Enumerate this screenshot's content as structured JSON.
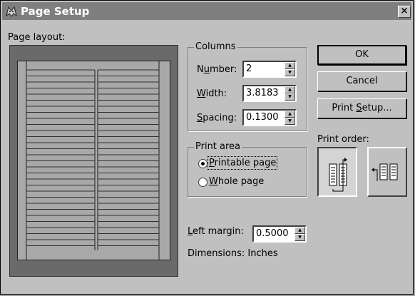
{
  "window": {
    "title": "Page Setup",
    "close_glyph": "×",
    "icon": "app-icon"
  },
  "page_layout": {
    "label": "Page layout:",
    "columns_shown": 2
  },
  "columns": {
    "group_label": "Columns",
    "number": {
      "label_pre": "N",
      "label_key": "u",
      "label_post": "mber:",
      "value": "2"
    },
    "width": {
      "label_pre": "",
      "label_key": "W",
      "label_post": "idth:",
      "value": "3.8183"
    },
    "spacing": {
      "label_pre": "",
      "label_key": "S",
      "label_post": "pacing:",
      "value": "0.1300"
    }
  },
  "print_area": {
    "group_label": "Print area",
    "options": [
      {
        "label_pre": "",
        "label_key": "P",
        "label_post": "rintable page",
        "selected": true
      },
      {
        "label_pre": "",
        "label_key": "W",
        "label_post": "hole page",
        "selected": false
      }
    ]
  },
  "left_margin": {
    "label_pre": "",
    "label_key": "L",
    "label_post": "eft margin:",
    "value": "0.5000"
  },
  "dimensions_text": "Dimensions: Inches",
  "buttons": {
    "ok": "OK",
    "cancel": "Cancel",
    "print_setup_pre": "Print ",
    "print_setup_key": "S",
    "print_setup_post": "etup..."
  },
  "print_order": {
    "label": "Print order:",
    "options": [
      {
        "name": "down-then-across-icon",
        "selected": true
      },
      {
        "name": "across-then-down-icon",
        "selected": false
      }
    ]
  },
  "colors": {
    "titlebar": "#7f7f7f",
    "dialog_face": "#c0c0c0",
    "preview_bg": "#6a6a6a"
  }
}
